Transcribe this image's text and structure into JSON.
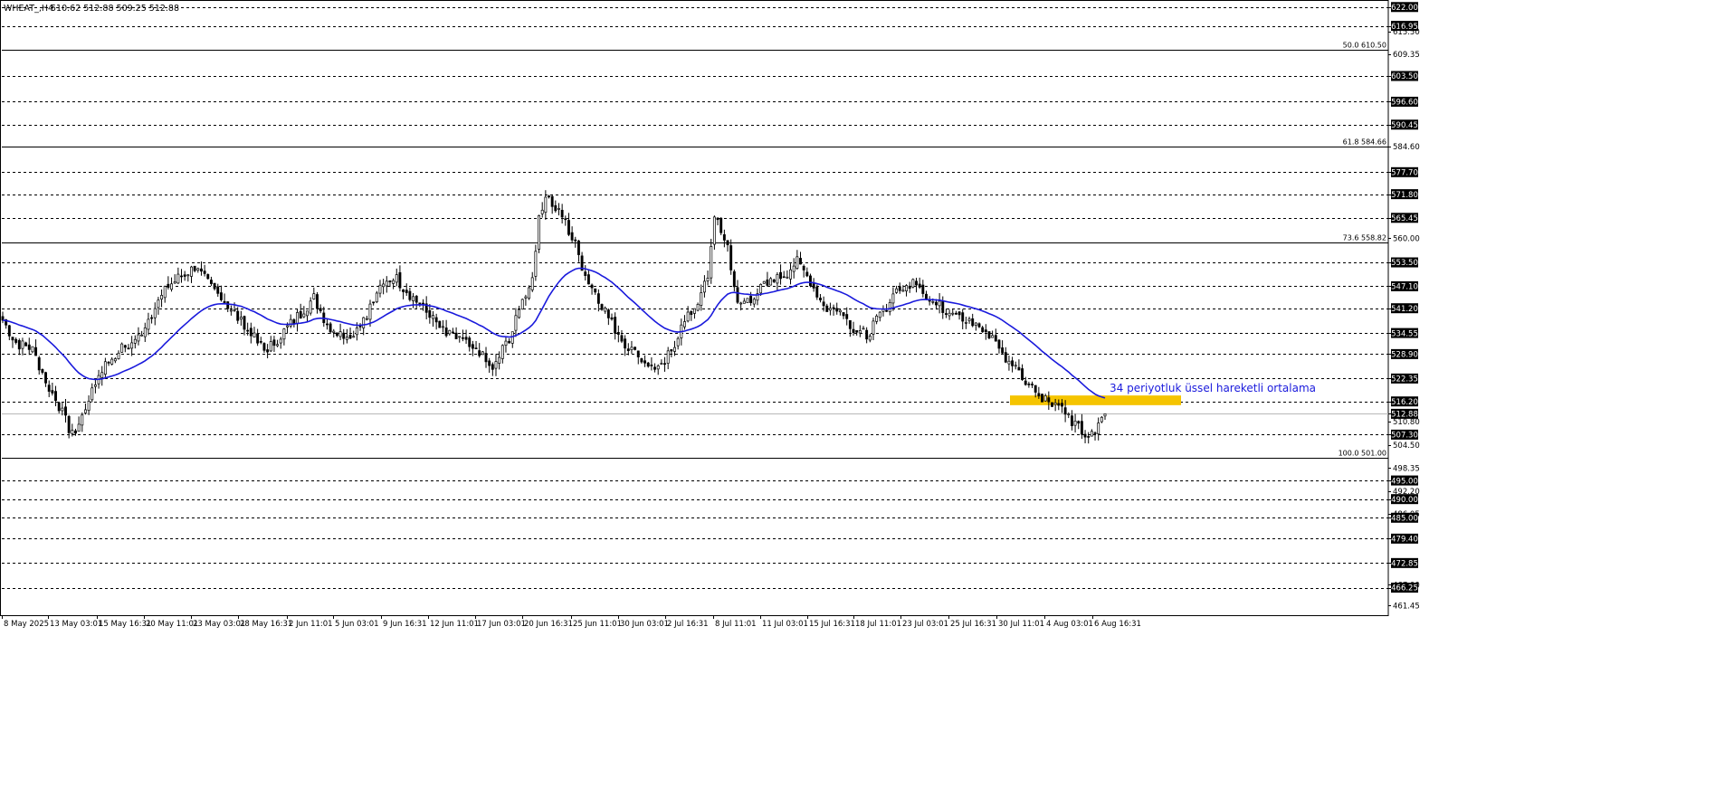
{
  "header": {
    "symbol": "WHEAT_,H4",
    "ohlc": "510.62 512.88 509.25 512.88"
  },
  "colors": {
    "background": "#ffffff",
    "grid": "#000000",
    "bull_candle": "#000000",
    "bear_candle": "#000000",
    "ema": "#1a1adc",
    "annotation_text": "#1a1adc",
    "highlight_zone": "#f5c400",
    "badge_bg": "#000000",
    "badge_text": "#ffffff"
  },
  "chart_data": {
    "type": "candlestick",
    "symbol": "WHEAT_",
    "timeframe": "H4",
    "ylim": [
      459.1,
      623.4
    ],
    "y_ticks": [
      "622.00",
      "616.95",
      "615.50",
      "609.35",
      "603.50",
      "596.60",
      "590.45",
      "584.60",
      "577.70",
      "571.80",
      "565.45",
      "560.00",
      "553.50",
      "547.10",
      "541.20",
      "534.55",
      "528.90",
      "522.35",
      "516.20",
      "512.88",
      "510.80",
      "507.30",
      "504.50",
      "498.35",
      "495.00",
      "492.20",
      "490.00",
      "486.05",
      "485.00",
      "479.40",
      "472.85",
      "467.00",
      "466.25",
      "461.45"
    ],
    "badge_levels": [
      "622.00",
      "616.95",
      "603.50",
      "596.60",
      "590.45",
      "577.70",
      "571.80",
      "565.45",
      "553.50",
      "547.10",
      "541.20",
      "534.55",
      "528.90",
      "522.35",
      "516.20",
      "512.88",
      "507.30",
      "495.00",
      "490.00",
      "485.00",
      "479.40",
      "472.85",
      "466.25"
    ],
    "dashed_levels": [
      622.0,
      616.95,
      603.5,
      596.6,
      590.45,
      577.7,
      571.8,
      565.45,
      553.5,
      547.1,
      541.2,
      534.55,
      528.9,
      522.35,
      516.2,
      507.3,
      495.0,
      490.0,
      485.0,
      479.4,
      472.85,
      466.25
    ],
    "fib_levels": [
      {
        "label": "50.0 610.50",
        "value": 610.5
      },
      {
        "label": "61.8 584.66",
        "value": 584.66
      },
      {
        "label": "73.6 558.82",
        "value": 558.82
      },
      {
        "label": "100.0 501.00",
        "value": 501.0
      }
    ],
    "current_price": 512.88,
    "x_ticks": [
      "8 May 2025",
      "13 May 03:01",
      "15 May 16:31",
      "20 May 11:01",
      "23 May 03:01",
      "28 May 16:31",
      "2 Jun 11:01",
      "5 Jun 03:01",
      "9 Jun 16:31",
      "12 Jun 11:01",
      "17 Jun 03:01",
      "20 Jun 16:31",
      "25 Jun 11:01",
      "30 Jun 03:01",
      "2 Jul 16:31",
      "8 Jul 11:01",
      "11 Jul 03:01",
      "15 Jul 16:31",
      "18 Jul 11:01",
      "23 Jul 03:01",
      "25 Jul 16:31",
      "30 Jul 11:01",
      "4 Aug 03:01",
      "6 Aug 16:31"
    ],
    "anchors": [
      [
        0,
        538
      ],
      [
        4,
        532
      ],
      [
        9,
        530
      ],
      [
        14,
        520
      ],
      [
        18,
        513
      ],
      [
        21,
        507
      ],
      [
        24,
        512
      ],
      [
        27,
        520
      ],
      [
        31,
        526
      ],
      [
        35,
        530
      ],
      [
        40,
        532
      ],
      [
        45,
        540
      ],
      [
        50,
        547
      ],
      [
        54,
        550
      ],
      [
        58,
        552
      ],
      [
        62,
        548
      ],
      [
        66,
        544
      ],
      [
        70,
        540
      ],
      [
        73,
        536
      ],
      [
        76,
        533
      ],
      [
        79,
        530
      ],
      [
        82,
        532
      ],
      [
        86,
        536
      ],
      [
        90,
        540
      ],
      [
        94,
        544
      ],
      [
        98,
        537
      ],
      [
        102,
        534
      ],
      [
        106,
        535
      ],
      [
        110,
        540
      ],
      [
        114,
        546
      ],
      [
        118,
        550
      ],
      [
        122,
        546
      ],
      [
        126,
        542
      ],
      [
        130,
        538
      ],
      [
        134,
        534
      ],
      [
        138,
        533
      ],
      [
        142,
        530
      ],
      [
        145,
        528
      ],
      [
        148,
        524
      ],
      [
        151,
        530
      ],
      [
        154,
        535
      ],
      [
        157,
        543
      ],
      [
        160,
        550
      ],
      [
        162,
        566
      ],
      [
        164,
        572
      ],
      [
        167,
        568
      ],
      [
        170,
        564
      ],
      [
        173,
        558
      ],
      [
        176,
        550
      ],
      [
        180,
        544
      ],
      [
        184,
        537
      ],
      [
        188,
        532
      ],
      [
        192,
        528
      ],
      [
        196,
        526
      ],
      [
        199,
        525
      ],
      [
        202,
        530
      ],
      [
        205,
        536
      ],
      [
        208,
        540
      ],
      [
        211,
        545
      ],
      [
        213,
        550
      ],
      [
        215,
        565
      ],
      [
        217,
        562
      ],
      [
        219,
        558
      ],
      [
        222,
        542
      ],
      [
        226,
        544
      ],
      [
        230,
        547
      ],
      [
        234,
        549
      ],
      [
        237,
        551
      ],
      [
        240,
        554
      ],
      [
        243,
        550
      ],
      [
        246,
        545
      ],
      [
        249,
        540
      ],
      [
        252,
        542
      ],
      [
        255,
        538
      ],
      [
        258,
        535
      ],
      [
        261,
        534
      ],
      [
        264,
        538
      ],
      [
        267,
        542
      ],
      [
        270,
        546
      ],
      [
        273,
        547
      ],
      [
        276,
        549
      ],
      [
        279,
        545
      ],
      [
        282,
        542
      ],
      [
        285,
        541
      ],
      [
        288,
        541
      ],
      [
        291,
        538
      ],
      [
        294,
        536
      ],
      [
        297,
        535
      ],
      [
        300,
        532
      ],
      [
        303,
        528
      ],
      [
        306,
        525
      ],
      [
        309,
        522
      ],
      [
        312,
        519
      ],
      [
        315,
        517
      ],
      [
        318,
        516
      ],
      [
        320,
        514
      ],
      [
        322,
        512
      ],
      [
        324,
        510
      ],
      [
        326,
        508
      ],
      [
        328,
        506
      ],
      [
        330,
        508
      ],
      [
        332,
        511
      ],
      [
        333,
        513
      ]
    ],
    "ema": {
      "label": "34 periyotluk üssel hareketli ortalama",
      "period": 34
    },
    "zone": {
      "low": 515.2,
      "high": 517.8
    }
  }
}
